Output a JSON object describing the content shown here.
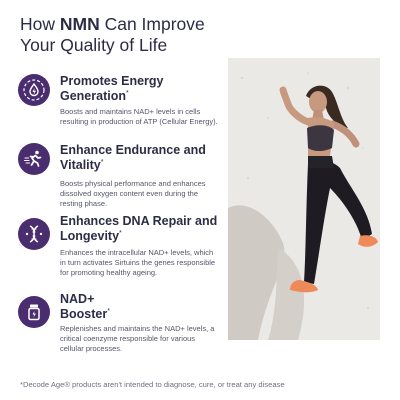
{
  "title": {
    "prefix": "How ",
    "brand": "NMN",
    "rest": " Can Improve Your Quality of Life"
  },
  "benefits": [
    {
      "icon": "energy-drop-icon",
      "heading": "Promotes Energy Generation",
      "marker": "*",
      "body": "Boosts and maintains NAD+ levels in cells resulting in production of ATP (Cellular Energy)."
    },
    {
      "icon": "running-person-icon",
      "heading": "Enhance Endurance and Vitality",
      "marker": "*",
      "body": "Boosts physical performance and enhances dissolved oxygen content even during the resting phase."
    },
    {
      "icon": "dna-helix-icon",
      "heading": "Enhances DNA Repair and Longevity",
      "marker": "*",
      "body": "Enhances the intracellular NAD+ levels, which in turn activates Sirtuins the genes responsible for promoting healthy ageing."
    },
    {
      "icon": "supplement-jar-icon",
      "heading": "NAD+ Booster",
      "marker": "*",
      "body": "Replenishes and maintains the NAD+ levels, a critical coenzyme responsible for various cellular processes."
    }
  ],
  "photo": {
    "icon": "athlete-running-photo"
  },
  "disclaimer": "*Decode Age® products aren't intended to diagnose, cure, or treat any disease",
  "colors": {
    "accent": "#4a2d6f",
    "heading": "#2c2d45",
    "body": "#55566a",
    "photo_bg": "#ebe9e5"
  }
}
